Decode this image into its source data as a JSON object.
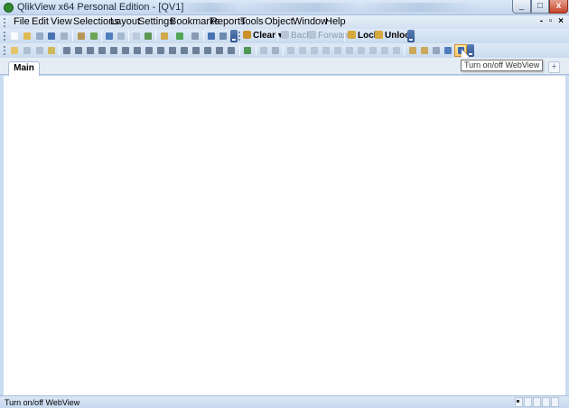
{
  "window": {
    "title": "QlikView x64 Personal Edition - [QV1]",
    "mdi_controls": "- ▫ ×"
  },
  "menu": {
    "items": [
      "File",
      "Edit",
      "View",
      "Selections",
      "Layout",
      "Settings",
      "Bookmarks",
      "Reports",
      "Tools",
      "Object",
      "Window",
      "Help"
    ]
  },
  "toolbar": {
    "clear_label": "Clear",
    "back_label": "Back",
    "forward_label": "Forward",
    "lock_label": "Lock",
    "unlock_label": "Unlock"
  },
  "tooltip": {
    "text": "Turn on/off WebView"
  },
  "tabs": {
    "sheets": [
      "Main"
    ],
    "add_label": "+"
  },
  "status": {
    "text": "Turn on/off WebView"
  },
  "colors": {
    "chrome": "#c9dcf2",
    "toolbar": "#dfe9f6",
    "highlight": "#ffc860"
  }
}
